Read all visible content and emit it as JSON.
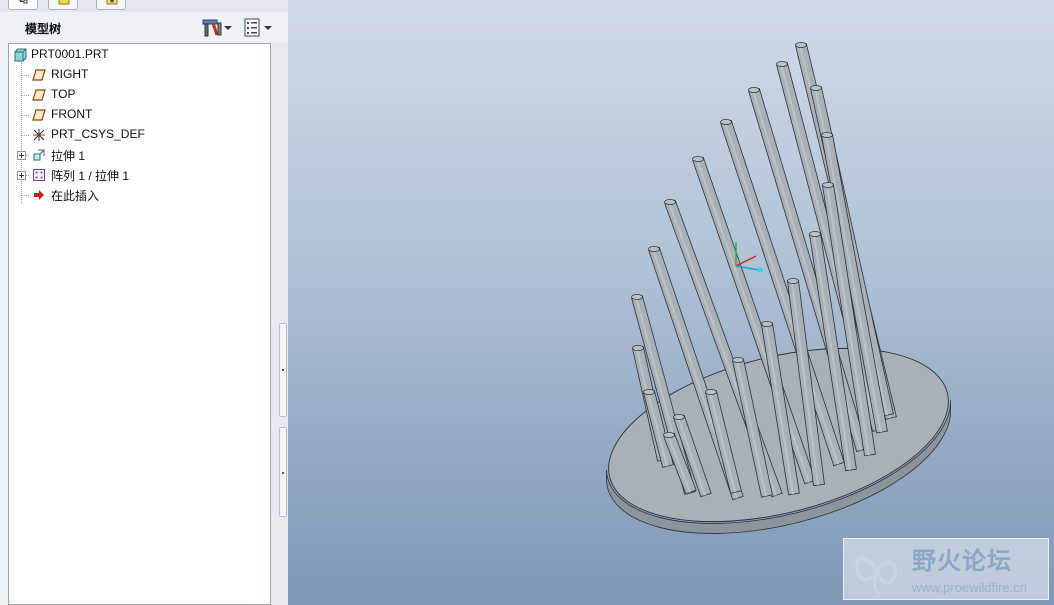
{
  "model_tree": {
    "title": "模型树",
    "tabs": [
      {
        "name": "model-tree",
        "icon": "model-tree-icon"
      },
      {
        "name": "folder-browser",
        "icon": "folder-icon"
      },
      {
        "name": "favorites",
        "icon": "favorites-icon"
      }
    ],
    "toolbar": {
      "settings_icon": "tools-settings-icon",
      "show_icon": "show-list-icon"
    },
    "items": [
      {
        "label": "PRT0001.PRT",
        "icon": "part-icon"
      },
      {
        "label": "RIGHT",
        "icon": "datum-plane-icon"
      },
      {
        "label": "TOP",
        "icon": "datum-plane-icon"
      },
      {
        "label": "FRONT",
        "icon": "datum-plane-icon"
      },
      {
        "label": "PRT_CSYS_DEF",
        "icon": "coordinate-system-icon"
      },
      {
        "label": "拉伸 1",
        "icon": "extrude-icon"
      },
      {
        "label": "阵列 1 / 拉伸 1",
        "icon": "pattern-icon"
      },
      {
        "label": "在此插入",
        "icon": "insert-here-arrow-icon"
      }
    ]
  },
  "viewport": {
    "model": "cylinder-pin-array-on-elliptical-base",
    "colors": {
      "model_fill": "#a9b0b6",
      "model_edge": "#2c3035",
      "background_top": "#cfdbe8",
      "background_bottom": "#7f98b7"
    }
  },
  "watermark": {
    "name": "野火论坛",
    "url": "www.proewildfire.cn"
  }
}
